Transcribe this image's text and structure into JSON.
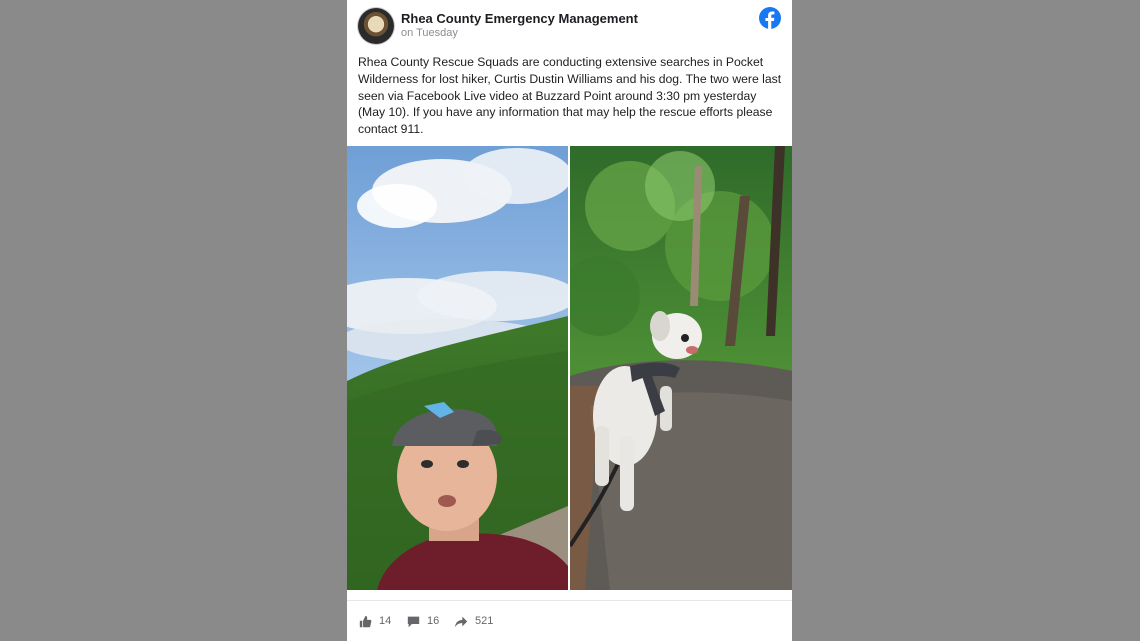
{
  "post": {
    "page_name": "Rhea County Emergency Management",
    "time": "on Tuesday",
    "text": "Rhea County Rescue Squads are conducting extensive searches in Pocket Wilderness for lost hiker, Curtis Dustin Williams and his dog. The two were last seen via Facebook Live video at Buzzard Point around 3:30 pm yesterday (May 10). If you have any information that may help the rescue efforts please contact 911.",
    "photos": [
      {
        "icon": "selfie-photo",
        "subject": "man in cap on cliff overlook"
      },
      {
        "icon": "dog-photo",
        "subject": "white dog on leash on rock"
      }
    ]
  },
  "actions": {
    "likes": "14",
    "comments": "16",
    "shares": "521"
  },
  "colors": {
    "facebook_blue": "#1877f2",
    "background": "#8a8a8a"
  }
}
